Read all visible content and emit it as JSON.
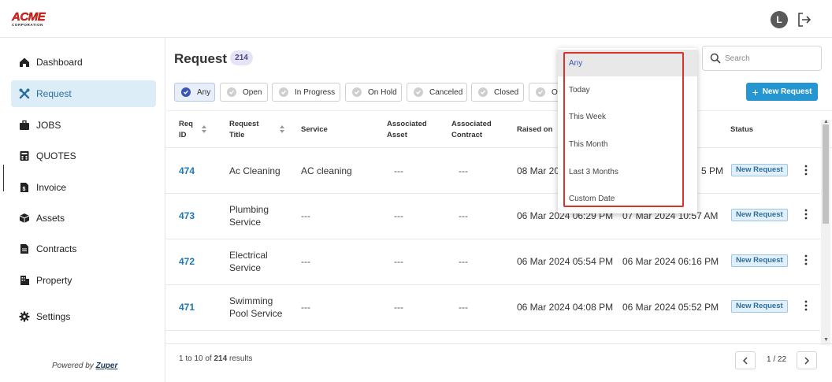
{
  "brand": {
    "logo_text": "ACME",
    "logo_subtext": "CORPORATION"
  },
  "header": {
    "avatar_initial": "L"
  },
  "sidebar": {
    "items": [
      {
        "label": "Dashboard",
        "icon": "home-icon"
      },
      {
        "label": "Request",
        "icon": "tools-icon",
        "active": true
      },
      {
        "label": "JOBS",
        "icon": "briefcase-icon"
      },
      {
        "label": "QUOTES",
        "icon": "calculator-icon"
      },
      {
        "label": "Invoice",
        "icon": "invoice-icon"
      },
      {
        "label": "Assets",
        "icon": "cube-icon"
      },
      {
        "label": "Contracts",
        "icon": "document-icon"
      },
      {
        "label": "Property",
        "icon": "building-icon"
      },
      {
        "label": "Settings",
        "icon": "gear-icon"
      }
    ],
    "powered_prefix": "Powered by",
    "powered_brand": "Zuper"
  },
  "main": {
    "title": "Request",
    "count": "214",
    "search_placeholder": "Search",
    "filters": [
      "Any",
      "Open",
      "In Progress",
      "On Hold",
      "Canceled",
      "Closed",
      "Ot"
    ],
    "active_filter": "Any",
    "new_button": "New Request",
    "columns": {
      "req_id_1": "Req",
      "req_id_2": "ID",
      "title_1": "Request",
      "title_2": "Title",
      "service": "Service",
      "asset_1": "Associated",
      "asset_2": "Asset",
      "contract_1": "Associated",
      "contract_2": "Contract",
      "raised_on": "Raised on",
      "status": "Status"
    },
    "rows": [
      {
        "id": "474",
        "title_1": "Ac Cleaning",
        "title_2": "",
        "service": "AC cleaning",
        "asset": "---",
        "contract": "---",
        "raised": "08 Mar 20",
        "updated": "5 PM",
        "status": "New Request"
      },
      {
        "id": "473",
        "title_1": "Plumbing",
        "title_2": "Service",
        "service": "---",
        "asset": "---",
        "contract": "---",
        "raised": "06 Mar 2024 06:29 PM",
        "updated": "07 Mar 2024 10:57 AM",
        "status": "New Request"
      },
      {
        "id": "472",
        "title_1": "Electrical",
        "title_2": "Service",
        "service": "---",
        "asset": "---",
        "contract": "---",
        "raised": "06 Mar 2024 05:54 PM",
        "updated": "06 Mar 2024 06:16 PM",
        "status": "New Request"
      },
      {
        "id": "471",
        "title_1": "Swimming",
        "title_2": "Pool Service",
        "service": "---",
        "asset": "---",
        "contract": "---",
        "raised": "06 Mar 2024 04:08 PM",
        "updated": "06 Mar 2024 05:52 PM",
        "status": "New Request"
      }
    ],
    "results_text": "1 to 10 of 214 results",
    "results_parts": {
      "start": "1",
      "to": "to",
      "end": "10",
      "of": "of",
      "total": "214",
      "suffix": "results"
    },
    "pagination": "1 / 22"
  },
  "date_dropdown": {
    "options": [
      "Any",
      "Today",
      "This Week",
      "This Month",
      "Last 3 Months",
      "Custom Date"
    ],
    "selected": "Any"
  },
  "colors": {
    "accent": "#2596d1",
    "active_nav_bg": "#dcedf7",
    "link": "#1f77b4",
    "highlight": "#d9342b"
  }
}
